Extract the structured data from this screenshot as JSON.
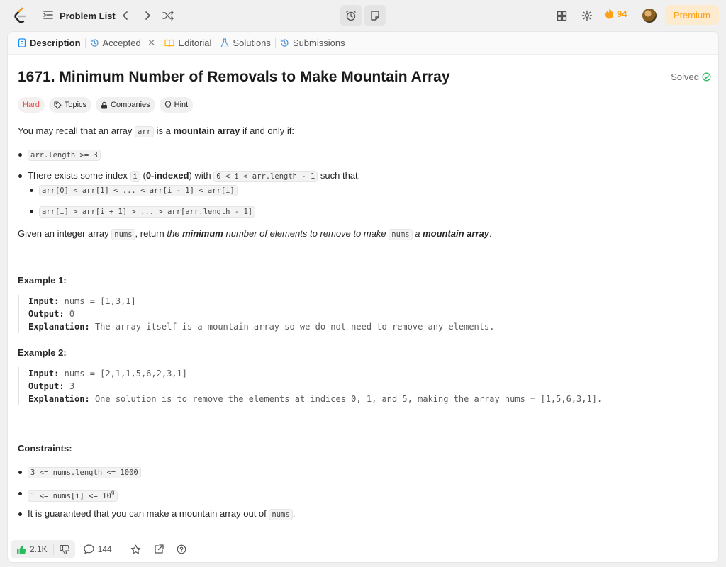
{
  "topnav": {
    "problem_list_label": "Problem List",
    "streak_count": "94",
    "premium_label": "Premium"
  },
  "tabs": {
    "description": "Description",
    "accepted": "Accepted",
    "editorial": "Editorial",
    "solutions": "Solutions",
    "submissions": "Submissions"
  },
  "problem": {
    "title": "1671. Minimum Number of Removals to Make Mountain Array",
    "status": "Solved",
    "difficulty": "Hard",
    "chips": {
      "topics": "Topics",
      "companies": "Companies",
      "hint": "Hint"
    },
    "intro": {
      "p1": "You may recall that an array",
      "code_arr": "arr",
      "p2": "is a",
      "bold": "mountain array",
      "p3": "if and only if:"
    },
    "cond1": "arr.length >= 3",
    "cond2": {
      "p1": "There exists some index",
      "code_i": "i",
      "p2": "(",
      "bold": "0-indexed",
      "p3": ") with",
      "code_range": "0 < i < arr.length - 1",
      "p4": "such that:",
      "sub1": "arr[0] < arr[1] < ... < arr[i - 1] < arr[i]",
      "sub2": "arr[i] > arr[i + 1] > ... > arr[arr.length - 1]"
    },
    "task": {
      "p1": "Given an integer array",
      "code_nums": "nums",
      "p2": ", return",
      "italic1": "the",
      "bold_italic": "minimum",
      "italic2": "number of elements to remove to make",
      "code_nums2": "nums",
      "italic3": "a",
      "bold_italic2": "mountain array",
      "p3": "."
    },
    "example1": {
      "heading": "Example 1:",
      "input_label": "Input:",
      "input": "nums = [1,3,1]",
      "output_label": "Output:",
      "output": "0",
      "explanation_label": "Explanation:",
      "explanation": "The array itself is a mountain array so we do not need to remove any elements."
    },
    "example2": {
      "heading": "Example 2:",
      "input_label": "Input:",
      "input": "nums = [2,1,1,5,6,2,3,1]",
      "output_label": "Output:",
      "output": "3",
      "explanation_label": "Explanation:",
      "explanation": "One solution is to remove the elements at indices 0, 1, and 5, making the array nums = [1,5,6,3,1]."
    },
    "constraints": {
      "heading": "Constraints:",
      "c1": "3 <= nums.length <= 1000",
      "c2_base": "1 <= nums[i] <= 10",
      "c2_exp": "9",
      "c3_text": "It is guaranteed that you can make a mountain array out of",
      "c3_code": "nums",
      "c3_end": "."
    }
  },
  "bottom": {
    "likes": "2.1K",
    "comments": "144"
  },
  "colors": {
    "accent": "#ffa116",
    "hard": "#ef4743",
    "solved": "#2cbb5d",
    "like": "#2cbb5d"
  }
}
